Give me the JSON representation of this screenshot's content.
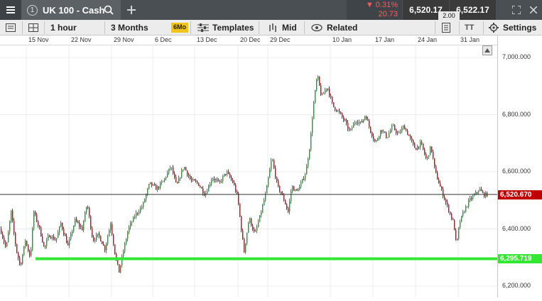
{
  "instrument": {
    "number": "1",
    "name": "UK 100 - Cash"
  },
  "quote": {
    "change_pct": "0.31%",
    "change_pts": "20.73",
    "sell": "6,520.17",
    "buy": "6,522.17",
    "spread": "2.00"
  },
  "toolbar": {
    "interval": "1 hour",
    "range": "3 Months",
    "range_badge": "6Mo",
    "templates": "Templates",
    "price_type": "Mid",
    "related": "Related",
    "settings": "Settings",
    "text_icon_label": "TT"
  },
  "dates": [
    "15 Nov",
    "22 Nov",
    "29 Nov",
    "6 Dec",
    "13 Dec",
    "20 Dec",
    "29 Dec",
    "10 Jan",
    "17 Jan",
    "24 Jan",
    "31 Jan"
  ],
  "y_ticks": [
    "7,000.000",
    "6,800.000",
    "6,600.000",
    "6,400.000",
    "6,200.000"
  ],
  "current_price_label": "6,520.670",
  "support_label": "6,295.719",
  "colors": {
    "up": "#1f9d2a",
    "down": "#d0021b",
    "support": "#33e833",
    "price_tag": "#c00000",
    "topbar": "#4a4f54"
  },
  "chart_data": {
    "type": "candlestick",
    "x_labels": [
      "15 Nov",
      "22 Nov",
      "29 Nov",
      "6 Dec",
      "13 Dec",
      "20 Dec",
      "29 Dec",
      "10 Jan",
      "17 Jan",
      "24 Jan",
      "31 Jan"
    ],
    "ylim": [
      6170,
      7020
    ],
    "y_ticks": [
      7000,
      6800,
      6600,
      6400,
      6200
    ],
    "current_price": 6520.67,
    "support_level": 6295.719,
    "grid": true,
    "close_path": [
      [
        0,
        6400
      ],
      [
        8,
        6330
      ],
      [
        15,
        6460
      ],
      [
        22,
        6330
      ],
      [
        28,
        6270
      ],
      [
        35,
        6360
      ],
      [
        42,
        6300
      ],
      [
        47,
        6460
      ],
      [
        55,
        6400
      ],
      [
        62,
        6330
      ],
      [
        68,
        6380
      ],
      [
        78,
        6360
      ],
      [
        85,
        6420
      ],
      [
        95,
        6340
      ],
      [
        105,
        6430
      ],
      [
        115,
        6400
      ],
      [
        122,
        6490
      ],
      [
        130,
        6360
      ],
      [
        138,
        6380
      ],
      [
        147,
        6330
      ],
      [
        155,
        6420
      ],
      [
        162,
        6300
      ],
      [
        167,
        6250
      ],
      [
        172,
        6310
      ],
      [
        180,
        6400
      ],
      [
        190,
        6450
      ],
      [
        200,
        6480
      ],
      [
        210,
        6560
      ],
      [
        220,
        6540
      ],
      [
        230,
        6570
      ],
      [
        240,
        6620
      ],
      [
        248,
        6550
      ],
      [
        258,
        6620
      ],
      [
        268,
        6570
      ],
      [
        278,
        6560
      ],
      [
        288,
        6520
      ],
      [
        298,
        6580
      ],
      [
        308,
        6560
      ],
      [
        318,
        6600
      ],
      [
        328,
        6560
      ],
      [
        334,
        6510
      ],
      [
        338,
        6420
      ],
      [
        343,
        6320
      ],
      [
        350,
        6440
      ],
      [
        358,
        6380
      ],
      [
        366,
        6450
      ],
      [
        374,
        6530
      ],
      [
        382,
        6650
      ],
      [
        390,
        6550
      ],
      [
        398,
        6510
      ],
      [
        405,
        6460
      ],
      [
        410,
        6550
      ],
      [
        416,
        6530
      ],
      [
        422,
        6550
      ],
      [
        430,
        6600
      ],
      [
        436,
        6700
      ],
      [
        440,
        6820
      ],
      [
        446,
        6940
      ],
      [
        452,
        6860
      ],
      [
        460,
        6900
      ],
      [
        468,
        6830
      ],
      [
        476,
        6810
      ],
      [
        484,
        6780
      ],
      [
        492,
        6740
      ],
      [
        500,
        6780
      ],
      [
        508,
        6770
      ],
      [
        514,
        6800
      ],
      [
        520,
        6750
      ],
      [
        528,
        6700
      ],
      [
        536,
        6750
      ],
      [
        544,
        6720
      ],
      [
        552,
        6760
      ],
      [
        560,
        6730
      ],
      [
        568,
        6760
      ],
      [
        576,
        6720
      ],
      [
        584,
        6680
      ],
      [
        592,
        6700
      ],
      [
        600,
        6640
      ],
      [
        606,
        6690
      ],
      [
        612,
        6600
      ],
      [
        620,
        6540
      ],
      [
        626,
        6500
      ],
      [
        632,
        6460
      ],
      [
        638,
        6420
      ],
      [
        642,
        6340
      ],
      [
        646,
        6420
      ],
      [
        652,
        6460
      ],
      [
        660,
        6500
      ],
      [
        668,
        6520
      ],
      [
        674,
        6540
      ],
      [
        680,
        6520
      ],
      [
        686,
        6520
      ]
    ]
  }
}
